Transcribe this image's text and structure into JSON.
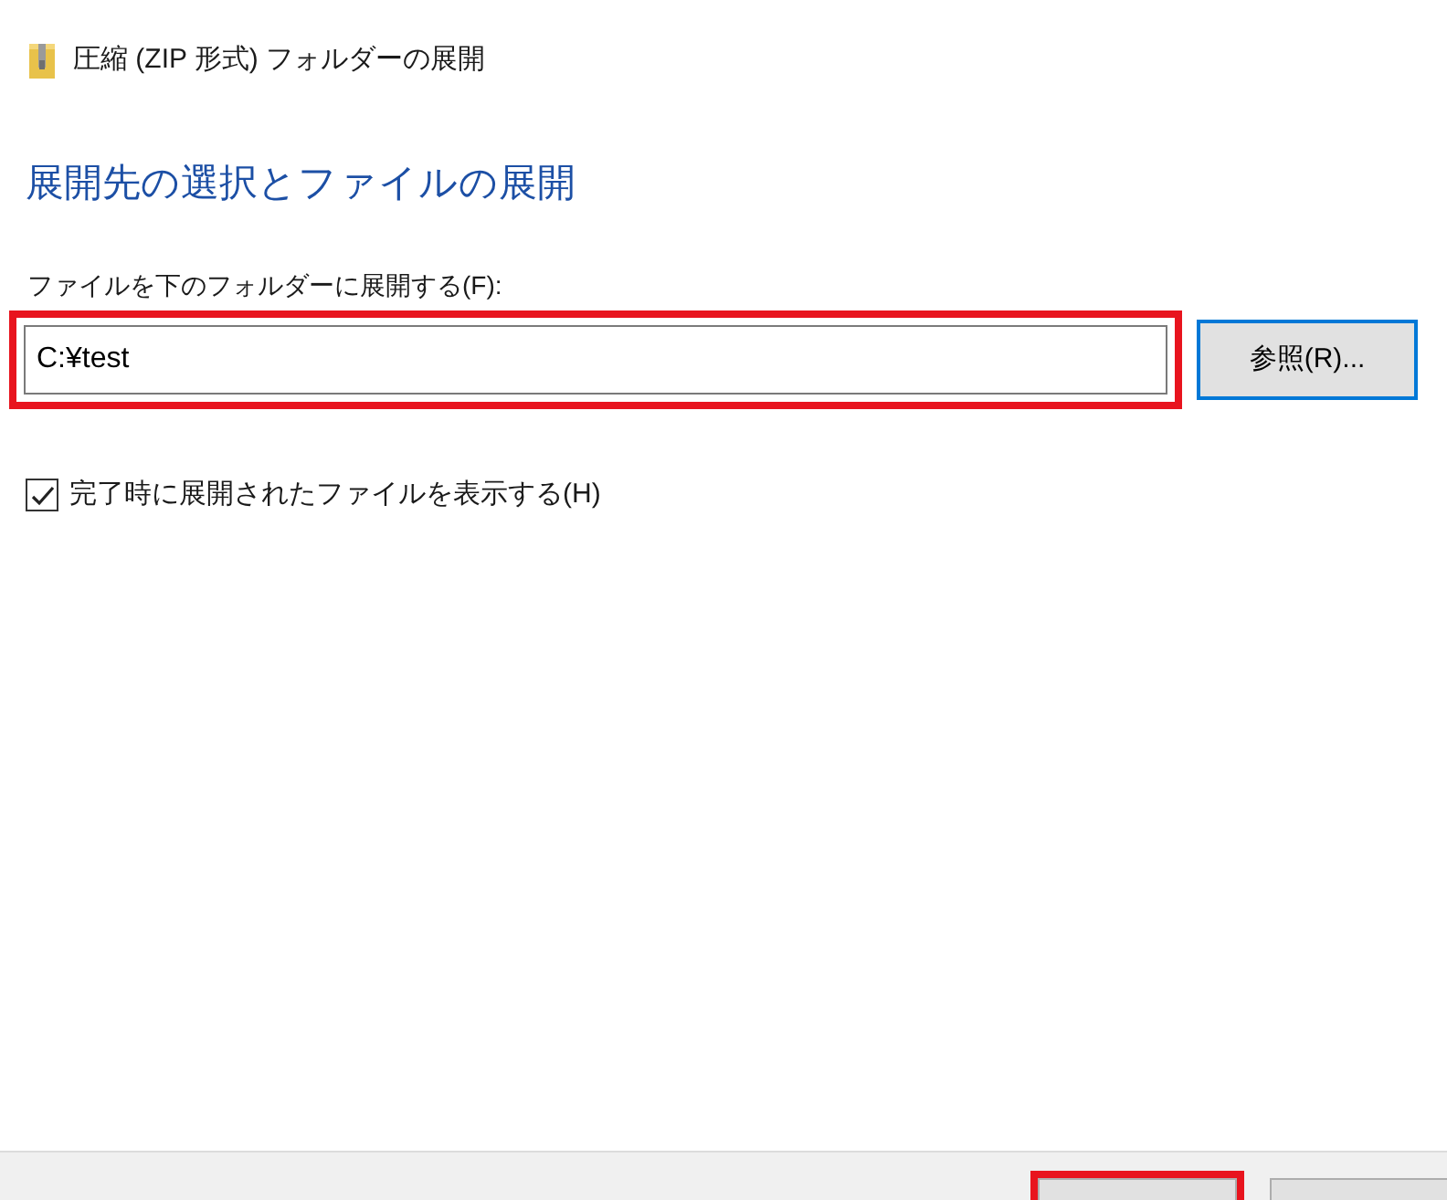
{
  "window": {
    "title": "圧縮 (ZIP 形式) フォルダーの展開"
  },
  "heading": "展開先の選択とファイルの展開",
  "destination": {
    "label": "ファイルを下のフォルダーに展開する(F):",
    "value": "C:¥test",
    "highlighted": true
  },
  "browse_button": {
    "label": "参照(R)...",
    "focused": true
  },
  "show_files": {
    "label": "完了時に展開されたファイルを表示する(H)",
    "checked": true
  },
  "footer_buttons": [
    {
      "highlighted": true
    },
    {
      "highlighted": false
    }
  ]
}
